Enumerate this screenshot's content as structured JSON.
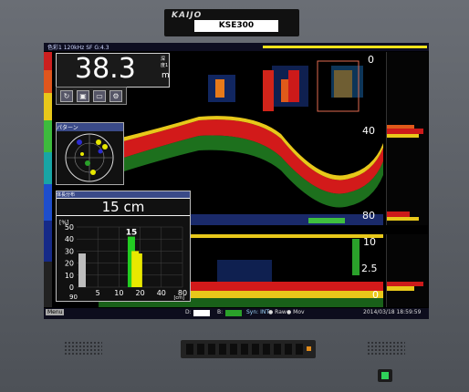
{
  "device": {
    "brand": "KAIJO",
    "model": "KSE300"
  },
  "header": {
    "info": "色彩1 120kHz SF G:4.3"
  },
  "depth": {
    "value": "38.3",
    "unit": "m",
    "mode_label": "深度1"
  },
  "range_upper": {
    "top": "0",
    "mid": "40",
    "bottom": "80"
  },
  "range_lower": {
    "top": "10",
    "mid": "2.5",
    "bottom": "0"
  },
  "toolbar": {
    "icons": [
      "refresh-icon",
      "camera-icon",
      "folder-icon",
      "settings-icon"
    ]
  },
  "sonar_panel": {
    "title": "パターン"
  },
  "histogram": {
    "title": "体長分布",
    "size_label": "15 cm",
    "peak_label": "15",
    "unit_label": "[%]",
    "corner_label": "90",
    "cm_label": "[cm]",
    "y_ticks": [
      "50",
      "40",
      "30",
      "20",
      "10",
      "0"
    ],
    "x_ticks": [
      "5",
      "10",
      "20",
      "40",
      "80"
    ]
  },
  "chart_data": {
    "type": "bar",
    "title": "15 cm",
    "ylabel": "[%]",
    "xlabel": "[cm]",
    "ylim": [
      0,
      50
    ],
    "bars": [
      {
        "x": 2,
        "value": 28,
        "color": "#bdbdbd"
      },
      {
        "x": 15,
        "value": 42,
        "color": "#22cc22"
      },
      {
        "x": 17,
        "value": 30,
        "color": "#e8e800"
      },
      {
        "x": 19,
        "value": 28,
        "color": "#e8e800"
      }
    ]
  },
  "statusbar": {
    "d_label": "D:",
    "b_label": "B:",
    "sync_label": "Syn: INT",
    "raw_label": "Raw",
    "mov_label": "Mov",
    "timestamp": "2014/03/18  18:59:59",
    "menu_label": "Menu"
  }
}
